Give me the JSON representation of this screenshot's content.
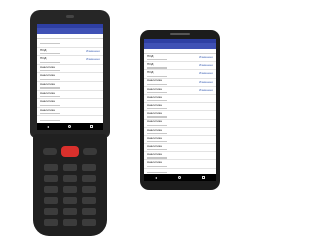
{
  "colors": {
    "primary": "#3f51b5",
    "status_dark": "#2e3fa3",
    "accent_red": "#d9302c",
    "link": "#3f62b5"
  },
  "scanner": {
    "app_title": "",
    "head_left": "",
    "head_right": "",
    "rows": [
      {
        "name": "",
        "status": ""
      },
      {
        "name": "ПОД",
        "status": "Изменено"
      },
      {
        "name": "ПОД",
        "status": "Изменено"
      },
      {
        "name": "Аналитика",
        "status": ""
      },
      {
        "name": "Аналитика",
        "status": ""
      },
      {
        "name": "Аналитика",
        "status": ""
      },
      {
        "name": "Аналитика",
        "status": ""
      },
      {
        "name": "Аналитика",
        "status": ""
      },
      {
        "name": "Аналитика",
        "status": ""
      },
      {
        "name": "",
        "status": ""
      }
    ]
  },
  "phone": {
    "app_title": "",
    "head_left": "",
    "head_right": "",
    "rows": [
      {
        "name": "ПОД",
        "status": "Изменено"
      },
      {
        "name": "ПОД",
        "status": "Изменено"
      },
      {
        "name": "ПОД",
        "status": "Изменено"
      },
      {
        "name": "Аналитика",
        "status": "Изменено"
      },
      {
        "name": "Аналитика",
        "status": "Изменено"
      },
      {
        "name": "Аналитика",
        "status": ""
      },
      {
        "name": "Аналитика",
        "status": ""
      },
      {
        "name": "Аналитика",
        "status": ""
      },
      {
        "name": "Аналитика",
        "status": ""
      },
      {
        "name": "Аналитика",
        "status": ""
      },
      {
        "name": "Аналитика",
        "status": ""
      },
      {
        "name": "Аналитика",
        "status": ""
      },
      {
        "name": "Аналитика",
        "status": ""
      },
      {
        "name": "Аналитика",
        "status": ""
      },
      {
        "name": "",
        "status": ""
      }
    ]
  },
  "icons": {
    "back": "back-triangle-icon",
    "home": "home-circle-icon",
    "recent": "recent-square-icon"
  }
}
